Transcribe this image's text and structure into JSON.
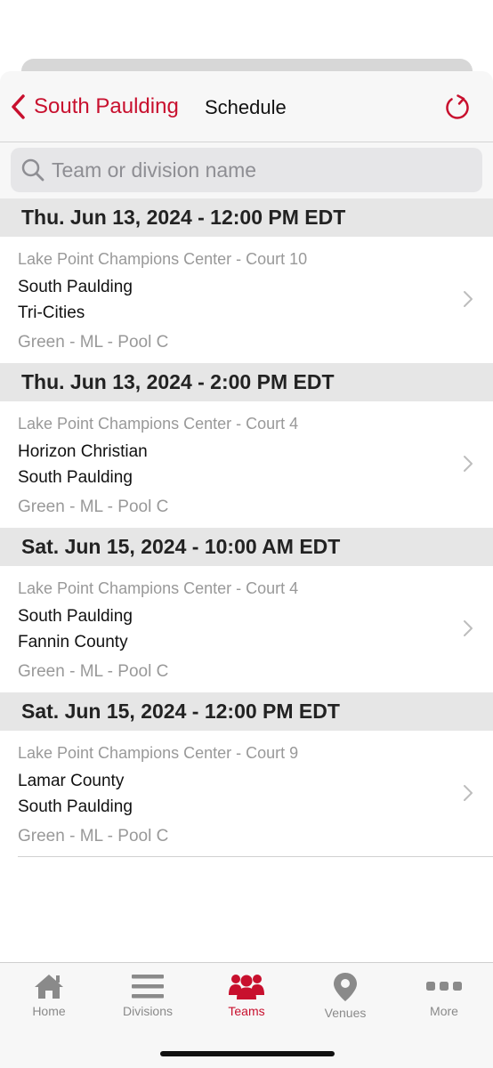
{
  "nav": {
    "back_label": "South Paulding",
    "title": "Schedule"
  },
  "search": {
    "placeholder": "Team or division name",
    "value": ""
  },
  "schedule": [
    {
      "header": "Thu. Jun 13, 2024 - 12:00 PM EDT",
      "venue": "Lake Point Champions Center - Court 10",
      "team1": "South Paulding",
      "team2": "Tri-Cities",
      "division": "Green - ML - Pool C"
    },
    {
      "header": "Thu. Jun 13, 2024 - 2:00 PM EDT",
      "venue": "Lake Point Champions Center - Court 4",
      "team1": "Horizon Christian",
      "team2": "South Paulding",
      "division": "Green - ML - Pool C"
    },
    {
      "header": "Sat. Jun 15, 2024 - 10:00 AM EDT",
      "venue": "Lake Point Champions Center - Court 4",
      "team1": "South Paulding",
      "team2": "Fannin County",
      "division": "Green - ML - Pool C"
    },
    {
      "header": "Sat. Jun 15, 2024 - 12:00 PM EDT",
      "venue": "Lake Point Champions Center - Court 9",
      "team1": "Lamar County",
      "team2": "South Paulding",
      "division": "Green - ML - Pool C"
    }
  ],
  "tabs": [
    {
      "label": "Home",
      "icon": "home-icon"
    },
    {
      "label": "Divisions",
      "icon": "list-icon"
    },
    {
      "label": "Teams",
      "icon": "people-icon"
    },
    {
      "label": "Venues",
      "icon": "location-pin-icon"
    },
    {
      "label": "More",
      "icon": "more-dots-icon"
    }
  ],
  "active_tab": "Teams",
  "colors": {
    "accent": "#c8102e",
    "inactive": "#8a8a8a",
    "section_bg": "#e6e6e6"
  }
}
